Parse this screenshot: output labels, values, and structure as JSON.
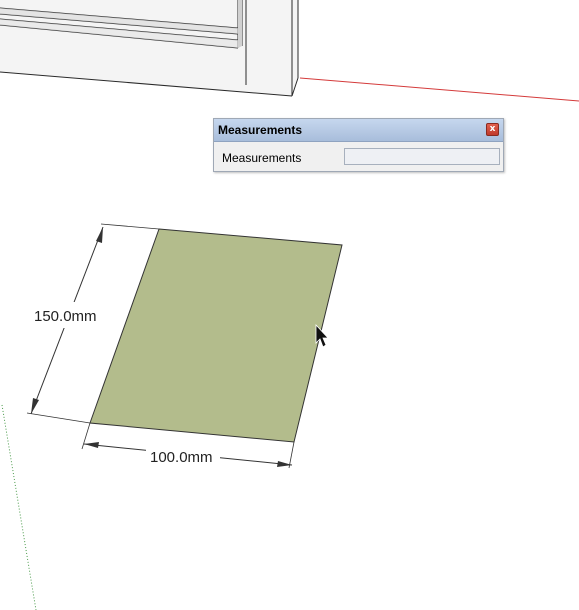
{
  "measurements_dialog": {
    "title": "Measurements",
    "label": "Measurements",
    "value": "",
    "close_label": "x"
  },
  "dimensions": {
    "height_label": "150.0mm",
    "width_label": "100.0mm"
  },
  "colors": {
    "rectangle_fill": "#b3bc8c",
    "red_axis": "#d43a3a",
    "green_axis": "#4a9a4a",
    "edge": "#333333"
  },
  "icons": {
    "cursor": "mouse-pointer-icon"
  }
}
